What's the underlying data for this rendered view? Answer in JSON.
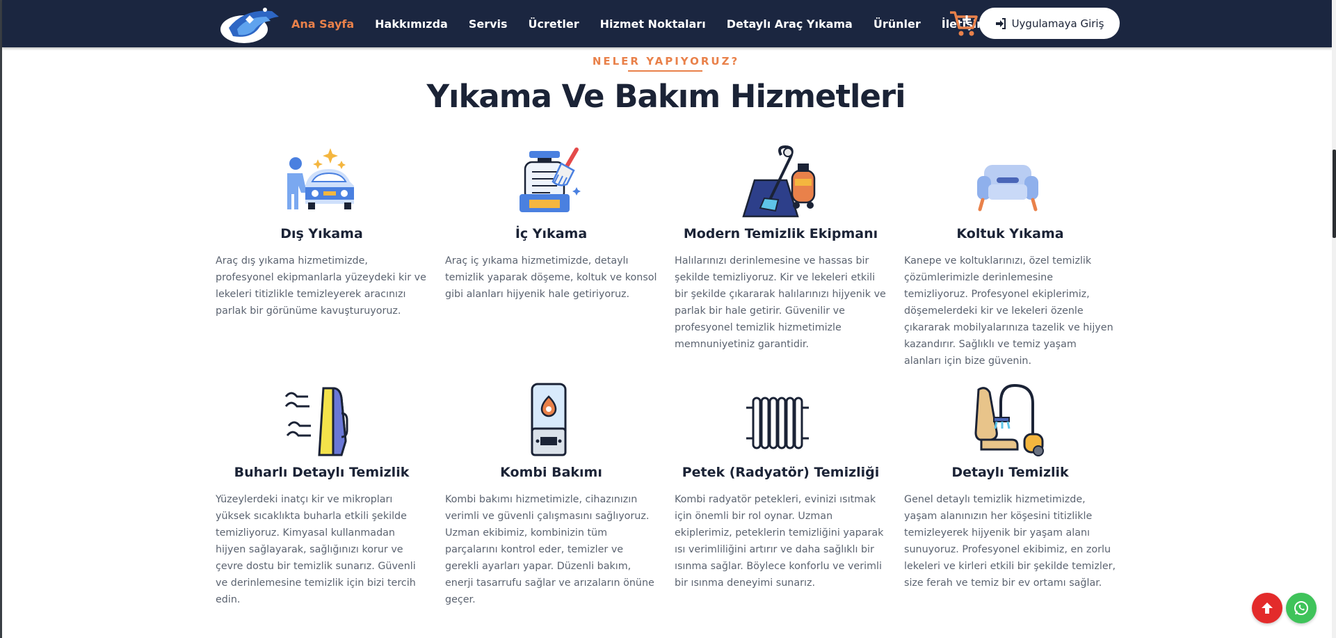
{
  "nav": {
    "items": [
      {
        "label": "Ana Sayfa",
        "active": true
      },
      {
        "label": "Hakkımızda",
        "active": false
      },
      {
        "label": "Servis",
        "active": false
      },
      {
        "label": "Ücretler",
        "active": false
      },
      {
        "label": "Hizmet Noktaları",
        "active": false
      },
      {
        "label": "Detaylı Araç Yıkama",
        "active": false
      },
      {
        "label": "Ürünler",
        "active": false
      },
      {
        "label": "İletişim",
        "active": false
      }
    ],
    "app_button_label": "Uygulamaya Giriş"
  },
  "section": {
    "eyebrow": "NELER YAPIYORUZ?",
    "title": "Yıkama Ve Bakım Hizmetleri"
  },
  "services": [
    {
      "title": "Dış Yıkama",
      "icon": "car-washer-icon",
      "description": "Araç dış yıkama hizmetimizde, profesyonel ekipmanlarla yüzeydeki kir ve lekeleri titizlikle temizleyerek aracınızı parlak bir görünüme kavuşturuyoruz."
    },
    {
      "title": "İç Yıkama",
      "icon": "interior-cleaning-icon",
      "description": "Araç iç yıkama hizmetimizde, detaylı temizlik yaparak döşeme, koltuk ve konsol gibi alanları hijyenik hale getiriyoruz."
    },
    {
      "title": "Modern Temizlik Ekipmanı",
      "icon": "carpet-vacuum-icon",
      "description": "Halılarınızı derinlemesine ve hassas bir şekilde temizliyoruz. Kir ve lekeleri etkili bir şekilde çıkararak halılarınızı hijyenik ve parlak bir hale getirir. Güvenilir ve profesyonel temizlik hizmetimizle memnuniyetiniz garantidir."
    },
    {
      "title": "Koltuk Yıkama",
      "icon": "sofa-icon",
      "description": "Kanepe ve koltuklarınızı, özel temizlik çözümlerimizle derinlemesine temizliyoruz. Profesyonel ekiplerimiz, döşemelerdeki kir ve lekeleri özenle çıkararak mobilyalarınıza tazelik ve hijyen kazandırır. Sağlıklı ve temiz yaşam alanları için bize güvenin."
    },
    {
      "title": "Buharlı Detaylı Temizlik",
      "icon": "steam-iron-icon",
      "description": "Yüzeylerdeki inatçı kir ve mikropları yüksek sıcaklıkta buharla etkili şekilde temizliyoruz. Kimyasal kullanmadan hijyen sağlayarak, sağlığınızı korur ve çevre dostu bir temizlik sunarız. Güvenli ve derinlemesine temizlik için bizi tercih edin."
    },
    {
      "title": "Kombi Bakımı",
      "icon": "boiler-icon",
      "description": "Kombi bakımı hizmetimizle, cihazınızın verimli ve güvenli çalışmasını sağlıyoruz. Uzman ekibimiz, kombinizin tüm parçalarını kontrol eder, temizler ve gerekli ayarları yapar. Düzenli bakım, enerji tasarrufu sağlar ve arızaların önüne geçer."
    },
    {
      "title": "Petek (Radyatör) Temizliği",
      "icon": "radiator-icon",
      "description": "Kombi radyatör petekleri, evinizi ısıtmak için önemli bir rol oynar. Uzman ekiplerimiz, peteklerin temizliğini yaparak ısı verimliliğini artırır ve daha sağlıklı bir ısınma sağlar. Böylece konforlu ve verimli bir ısınma deneyimi sunarız."
    },
    {
      "title": "Detaylı Temizlik",
      "icon": "seat-vacuum-icon",
      "description": "Genel detaylı temizlik hizmetimizde, yaşam alanınızın her köşesini titizlikle temizleyerek hijyenik bir yaşam alanı sunuyoruz. Profesyonel ekibimiz, en zorlu lekeleri ve kirleri etkili bir şekilde temizler, size ferah ve temiz bir ev ortamı sağlar."
    }
  ],
  "colors": {
    "navbar": "#1b2640",
    "accent": "#e9814a",
    "heading": "#1b2336",
    "text": "#5b6370",
    "scroll_top": "#e32b2b",
    "whatsapp": "#3fc35a"
  }
}
